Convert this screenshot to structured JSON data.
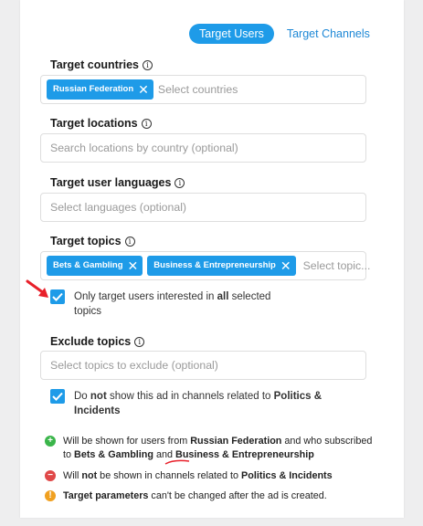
{
  "tabs": {
    "target_users": "Target Users",
    "target_channels": "Target Channels"
  },
  "countries": {
    "label": "Target countries",
    "chip": "Russian Federation",
    "placeholder": "Select countries"
  },
  "locations": {
    "label": "Target locations",
    "placeholder": "Search locations by country (optional)"
  },
  "languages": {
    "label": "Target user languages",
    "placeholder": "Select languages (optional)"
  },
  "topics": {
    "label": "Target topics",
    "chips": [
      "Bets & Gambling",
      "Business & Entrepreneurship"
    ],
    "placeholder": "Select topic..."
  },
  "only_interested": {
    "text_before": "Only target users interested in ",
    "text_bold": "all",
    "text_after": " selected topics"
  },
  "exclude": {
    "label": "Exclude topics",
    "placeholder": "Select topics to exclude (optional)"
  },
  "dont_show": {
    "text_before": "Do ",
    "text_bold_not": "not",
    "text_middle": " show this ad in channels related to ",
    "text_bold_topic": "Politics & Incidents"
  },
  "notices": {
    "shown": {
      "prefix": "Will be shown for users from ",
      "country": "Russian Federation",
      "middle": " and who subscribed to ",
      "topic1": "Bets & Gambling",
      "and": " and ",
      "topic2": "Business & Entrepreneurship"
    },
    "not_shown": {
      "prefix": "Will ",
      "not": "not",
      "middle": " be shown in channels related to ",
      "topic": "Politics & Incidents"
    },
    "warning": {
      "bold": "Target parameters",
      "rest": " can't be changed after the ad is created."
    }
  },
  "colors": {
    "accent": "#1e9be8",
    "success": "#3ab54a",
    "danger": "#e04848",
    "warning": "#f0a020",
    "annotation": "#e8202a"
  }
}
